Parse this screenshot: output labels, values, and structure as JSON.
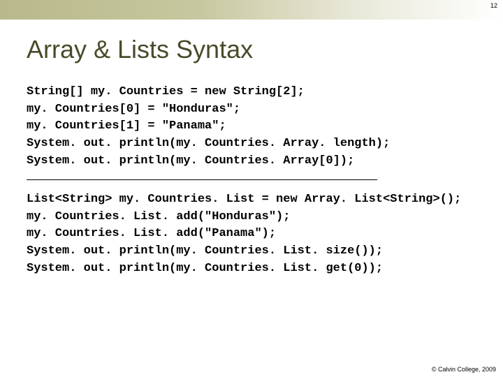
{
  "page_number": "12",
  "title": "Array & Lists Syntax",
  "code1": {
    "l1": "String[] my. Countries = new String[2];",
    "l2": "my. Countries[0] = \"Honduras\";",
    "l3": "my. Countries[1] = \"Panama\";",
    "l4": "System. out. println(my. Countries. Array. length);",
    "l5": "System. out. println(my. Countries. Array[0]);"
  },
  "code2": {
    "l1": "List<String> my. Countries. List = new Array. List<String>();",
    "l2": "my. Countries. List. add(\"Honduras\");",
    "l3": "my. Countries. List. add(\"Panama\");",
    "l4": "System. out. println(my. Countries. List. size());",
    "l5": "System. out. println(my. Countries. List. get(0));"
  },
  "footer": "© Calvin College, 2009"
}
